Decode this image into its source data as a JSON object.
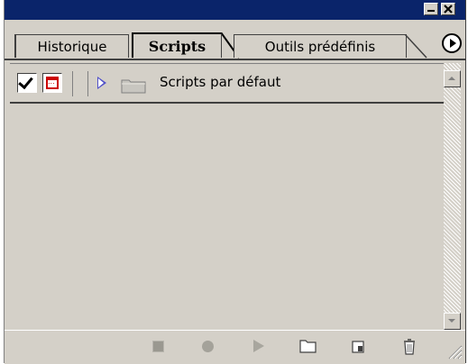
{
  "tabs": [
    {
      "label": "Historique",
      "active": false
    },
    {
      "label": "Scripts",
      "active": true
    },
    {
      "label": "Outils prédéfinis",
      "active": false
    }
  ],
  "actions_list": {
    "items": [
      {
        "label": "Scripts par défaut",
        "type": "set",
        "checked": true,
        "dialog_toggle": true,
        "expanded": false
      }
    ]
  },
  "toolbar": {
    "buttons": [
      "stop-icon",
      "record-icon",
      "play-icon",
      "new-set-icon",
      "new-action-icon",
      "trash-icon"
    ]
  },
  "colors": {
    "titlebar": "#0a246a",
    "panel": "#d4d0c8",
    "dialog_toggle": "#cc0000",
    "expand_arrow": "#5050c8"
  }
}
